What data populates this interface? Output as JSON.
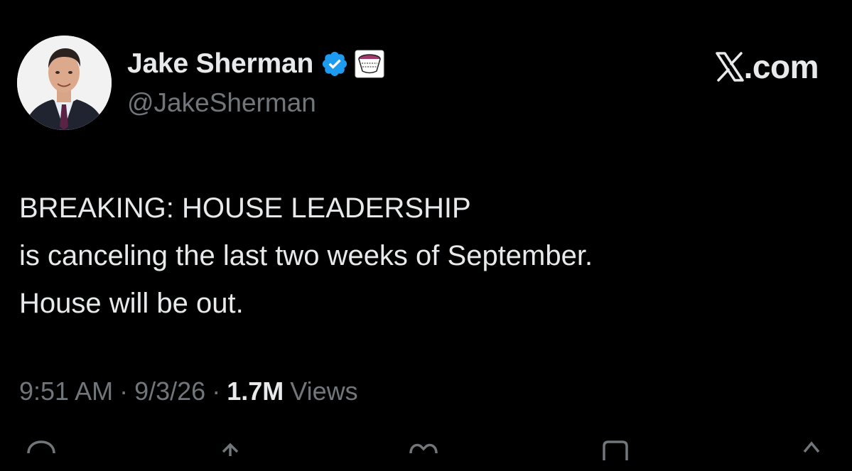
{
  "tweet": {
    "author": {
      "display_name": "Jake Sherman",
      "handle": "@JakeSherman",
      "verified": true
    },
    "brand": {
      "icon": "x-logo-icon",
      "text": ".com"
    },
    "text_lines": [
      "BREAKING: HOUSE LEADERSHIP",
      "is canceling the last two weeks of September.",
      "House will be out."
    ],
    "meta": {
      "time": "9:51 AM",
      "separator": "·",
      "date": "9/3/26",
      "views_count": "1.7M",
      "views_label": "Views"
    },
    "actions": [
      {
        "name": "reply",
        "icon": "reply-icon"
      },
      {
        "name": "repost",
        "icon": "repost-icon"
      },
      {
        "name": "like",
        "icon": "heart-icon"
      },
      {
        "name": "bookmark",
        "icon": "bookmark-icon"
      },
      {
        "name": "share",
        "icon": "share-icon"
      }
    ],
    "colors": {
      "background": "#000000",
      "text_primary": "#e7e9ea",
      "text_secondary": "#71767b",
      "verified_blue": "#1d9bf0"
    }
  }
}
